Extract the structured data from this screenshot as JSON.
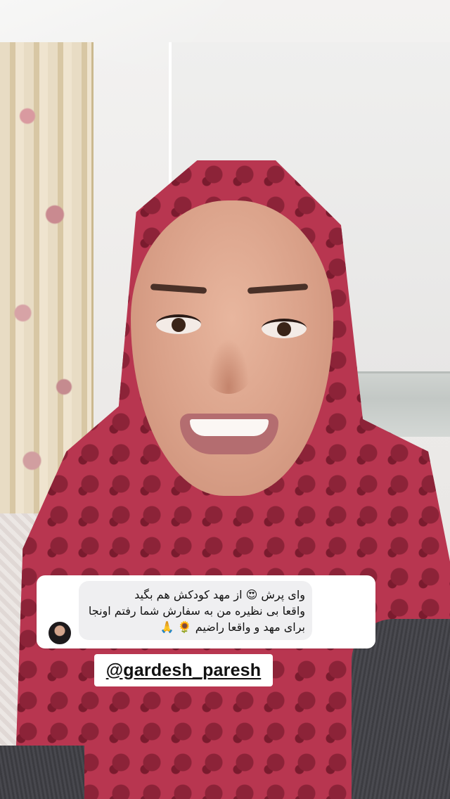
{
  "story": {
    "reply": {
      "text": "وای پرش 😍 از مهد کودکش هم بگید\nواقعا بی نظیره من به سفارش شما رفتم اونجا\nبرای مهد و واقعا راضیم 🌻 🙏"
    },
    "mention": {
      "text": "@gardesh_paresh"
    }
  }
}
